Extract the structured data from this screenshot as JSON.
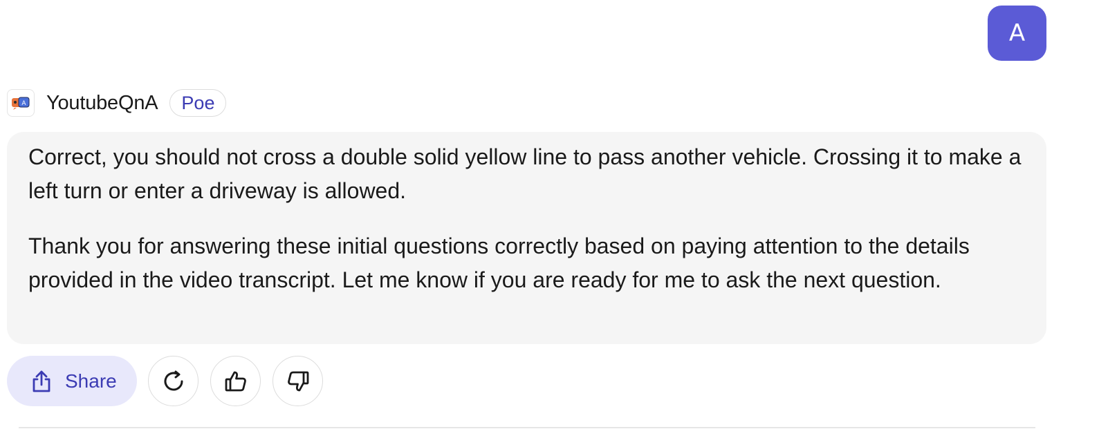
{
  "user": {
    "avatar_initial": "A",
    "avatar_color": "#5b5bd6"
  },
  "bot": {
    "avatar_icon": "youtube-qna-bot-icon",
    "name": "YoutubeQnA",
    "badge": "Poe"
  },
  "message": {
    "paragraphs": [
      "Correct, you should not cross a double solid yellow line to pass another vehicle. Crossing it to make a left turn or enter a driveway is allowed.",
      "Thank you for answering these initial questions correctly based on paying attention to the details provided in the video transcript. Let me know if you are ready for me to ask the next question."
    ]
  },
  "actions": {
    "share_label": "Share",
    "share_icon": "share-icon",
    "regenerate_icon": "refresh-icon",
    "like_icon": "thumbs-up-icon",
    "dislike_icon": "thumbs-down-icon"
  },
  "colors": {
    "accent": "#3b3bb3",
    "share_bg": "#e8e8fb",
    "bubble_bg": "#f5f5f5"
  }
}
